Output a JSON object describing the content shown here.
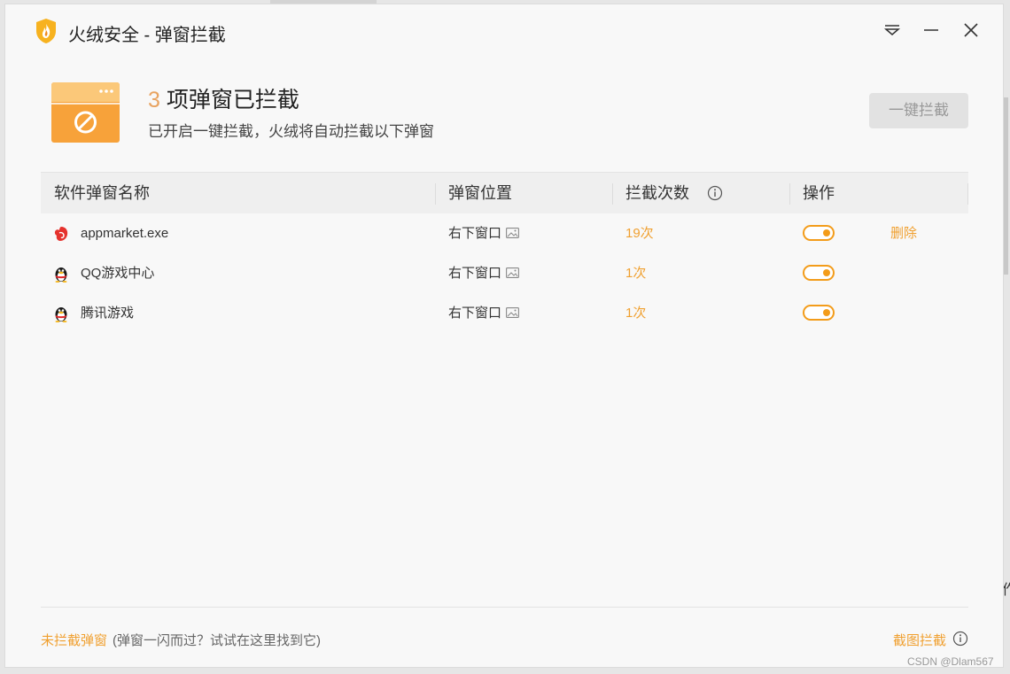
{
  "window": {
    "title": "火绒安全 - 弹窗拦截"
  },
  "header": {
    "count": "3",
    "title_suffix": " 项弹窗已拦截",
    "subtitle": "已开启一键拦截，火绒将自动拦截以下弹窗",
    "block_all_label": "一键拦截"
  },
  "table": {
    "columns": [
      "软件弹窗名称",
      "弹窗位置",
      "拦截次数",
      "操作"
    ],
    "rows": [
      {
        "name": "appmarket.exe",
        "icon": "appmarket-icon",
        "position": "右下窗口",
        "count": "19次",
        "enabled": true,
        "action": "删除"
      },
      {
        "name": "QQ游戏中心",
        "icon": "qq-penguin-icon",
        "position": "右下窗口",
        "count": "1次",
        "enabled": true,
        "action": ""
      },
      {
        "name": "腾讯游戏",
        "icon": "qq-penguin-icon",
        "position": "右下窗口",
        "count": "1次",
        "enabled": true,
        "action": ""
      }
    ]
  },
  "footer": {
    "unblocked_link": "未拦截弹窗",
    "unblocked_hint": "(弹窗一闪而过？试试在这里找到它)",
    "screenshot_block_label": "截图拦截"
  },
  "watermark": "CSDN @Dlam567",
  "colors": {
    "accent": "#f0a030",
    "toggle": "#f39c1a",
    "count_number": "#e8a360"
  }
}
